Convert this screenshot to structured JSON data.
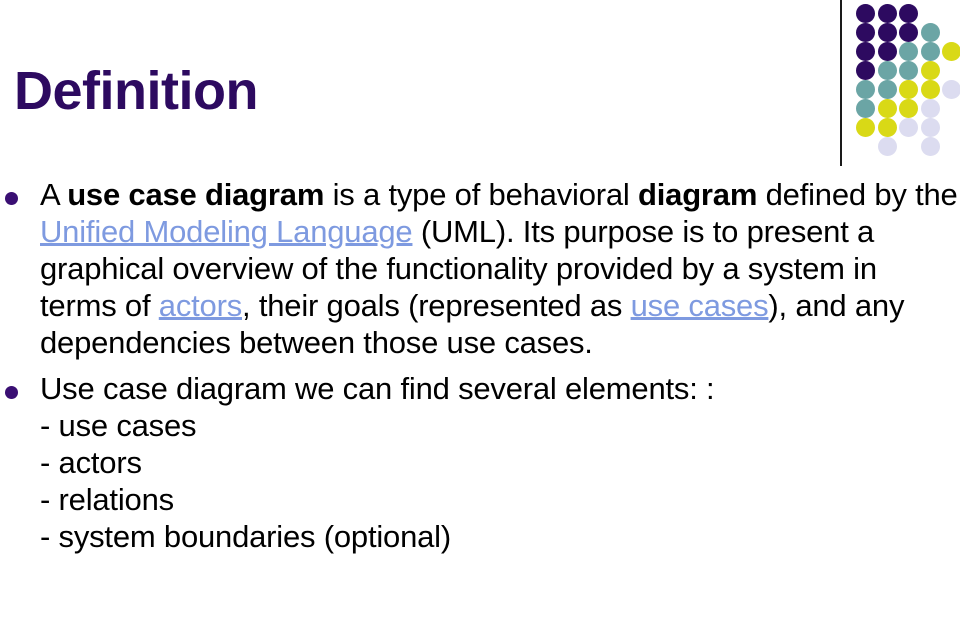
{
  "slide": {
    "title": "Definition",
    "title_color": "#2d0a60",
    "background": "#ffffff",
    "link_color": "#7e9ae0",
    "bullet_color": "#3a0f73",
    "divider_color": "#1a1a1a"
  },
  "bullets": [
    {
      "id": "bullet-1",
      "marker": "disc",
      "segments": [
        {
          "text": "A ",
          "style": "normal"
        },
        {
          "text": "use case diagram",
          "style": "bold"
        },
        {
          "text": " is a type of behavioral ",
          "style": "normal"
        },
        {
          "text": "diagram",
          "style": "bold"
        },
        {
          "text": " defined by the ",
          "style": "normal"
        },
        {
          "text": "Unified Modeling Language",
          "style": "link"
        },
        {
          "text": " (UML). Its purpose is to present a graphical overview of the functionality provided by a system in terms of ",
          "style": "normal"
        },
        {
          "text": "actors",
          "style": "link"
        },
        {
          "text": ", their goals (represented as ",
          "style": "normal"
        },
        {
          "text": "use cases",
          "style": "link"
        },
        {
          "text": "), and any dependencies between those use cases.",
          "style": "normal"
        }
      ]
    },
    {
      "id": "bullet-2",
      "marker": "disc",
      "segments": [
        {
          "text": "Use case diagram we can find several elements: :",
          "style": "normal"
        }
      ],
      "sub_items": [
        "- use cases",
        "- actors",
        "- relations",
        "- system boundaries (optional)"
      ]
    }
  ],
  "decoration": {
    "palette": {
      "purple": "#2d0a60",
      "teal": "#6ba5a5",
      "yellow": "#d9d916",
      "lavender": "#dcdcf0"
    },
    "dots": [
      {
        "col": 0,
        "row": 0,
        "color": "#2d0a60"
      },
      {
        "col": 1,
        "row": 0,
        "color": "#2d0a60"
      },
      {
        "col": 2,
        "row": 0,
        "color": "#2d0a60"
      },
      {
        "col": 0,
        "row": 1,
        "color": "#2d0a60"
      },
      {
        "col": 1,
        "row": 1,
        "color": "#2d0a60"
      },
      {
        "col": 2,
        "row": 1,
        "color": "#2d0a60"
      },
      {
        "col": 3,
        "row": 1,
        "color": "#6ba5a5"
      },
      {
        "col": 0,
        "row": 2,
        "color": "#2d0a60"
      },
      {
        "col": 1,
        "row": 2,
        "color": "#2d0a60"
      },
      {
        "col": 2,
        "row": 2,
        "color": "#6ba5a5"
      },
      {
        "col": 3,
        "row": 2,
        "color": "#6ba5a5"
      },
      {
        "col": 4,
        "row": 2,
        "color": "#d9d916"
      },
      {
        "col": 0,
        "row": 3,
        "color": "#2d0a60"
      },
      {
        "col": 1,
        "row": 3,
        "color": "#6ba5a5"
      },
      {
        "col": 2,
        "row": 3,
        "color": "#6ba5a5"
      },
      {
        "col": 3,
        "row": 3,
        "color": "#d9d916"
      },
      {
        "col": 0,
        "row": 4,
        "color": "#6ba5a5"
      },
      {
        "col": 1,
        "row": 4,
        "color": "#6ba5a5"
      },
      {
        "col": 2,
        "row": 4,
        "color": "#d9d916"
      },
      {
        "col": 3,
        "row": 4,
        "color": "#d9d916"
      },
      {
        "col": 4,
        "row": 4,
        "color": "#dcdcf0"
      },
      {
        "col": 0,
        "row": 5,
        "color": "#6ba5a5"
      },
      {
        "col": 1,
        "row": 5,
        "color": "#d9d916"
      },
      {
        "col": 2,
        "row": 5,
        "color": "#d9d916"
      },
      {
        "col": 3,
        "row": 5,
        "color": "#dcdcf0"
      },
      {
        "col": 0,
        "row": 6,
        "color": "#d9d916"
      },
      {
        "col": 1,
        "row": 6,
        "color": "#d9d916"
      },
      {
        "col": 2,
        "row": 6,
        "color": "#dcdcf0"
      },
      {
        "col": 3,
        "row": 6,
        "color": "#dcdcf0"
      },
      {
        "col": 1,
        "row": 7,
        "color": "#dcdcf0"
      },
      {
        "col": 3,
        "row": 7,
        "color": "#dcdcf0"
      }
    ]
  }
}
